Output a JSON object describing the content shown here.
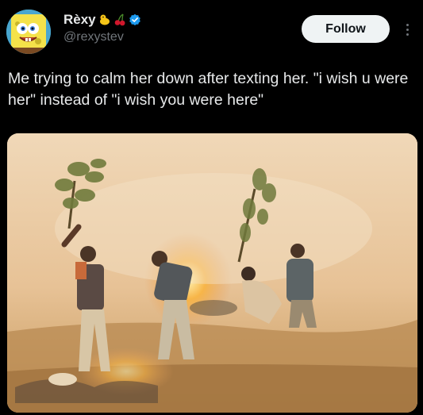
{
  "author": {
    "display_name": "Rèxy",
    "handle": "@rexystev",
    "verified": true,
    "name_emoji": [
      "duck-emoji",
      "cherry-emoji"
    ],
    "avatar": "spongebob-avatar"
  },
  "actions": {
    "follow_label": "Follow",
    "more_icon": "more-vertical-icon"
  },
  "tweet": {
    "text": "Me trying to calm her down after texting her. \"i wish u were her\" instead of \"i wish you were here\""
  },
  "media": {
    "type": "photo",
    "subject": "men-with-branches-fighting-fire"
  },
  "colors": {
    "background": "#000000",
    "text_primary": "#e7e9ea",
    "text_secondary": "#71767b",
    "verified_blue": "#1d9bf0",
    "follow_bg": "#eff3f4",
    "follow_text": "#0f1419"
  }
}
